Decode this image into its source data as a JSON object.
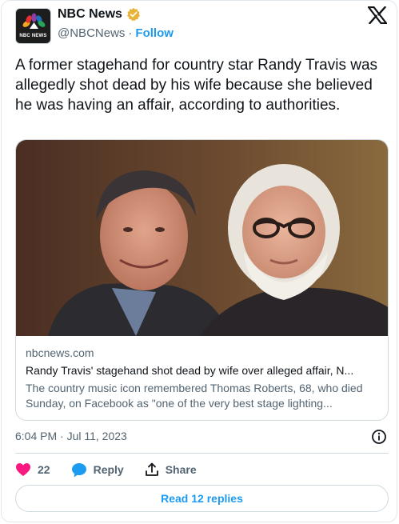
{
  "account": {
    "name": "NBC News",
    "handle": "@NBCNews",
    "separator": "·",
    "follow_label": "Follow",
    "avatar_brand": "NBC NEWS",
    "verified_color": "#e8b33a"
  },
  "tweet": {
    "text": "A former stagehand for country star Randy Travis was allegedly shot dead by his wife because she believed he was having an affair, according to authorities.",
    "timestamp": "6:04 PM · Jul 11, 2023"
  },
  "link_card": {
    "domain": "nbcnews.com",
    "title": "Randy Travis' stagehand shot dead by wife over alleged affair, N...",
    "description": "The country music icon remembered Thomas Roberts, 68, who died Sunday, on Facebook as \"one of the very best stage lighting..."
  },
  "actions": {
    "like_count": "22",
    "reply_label": "Reply",
    "share_label": "Share"
  },
  "read_replies_label": "Read 12 replies",
  "colors": {
    "accent": "#1d9bf0",
    "like": "#f91880",
    "muted": "#536471"
  }
}
